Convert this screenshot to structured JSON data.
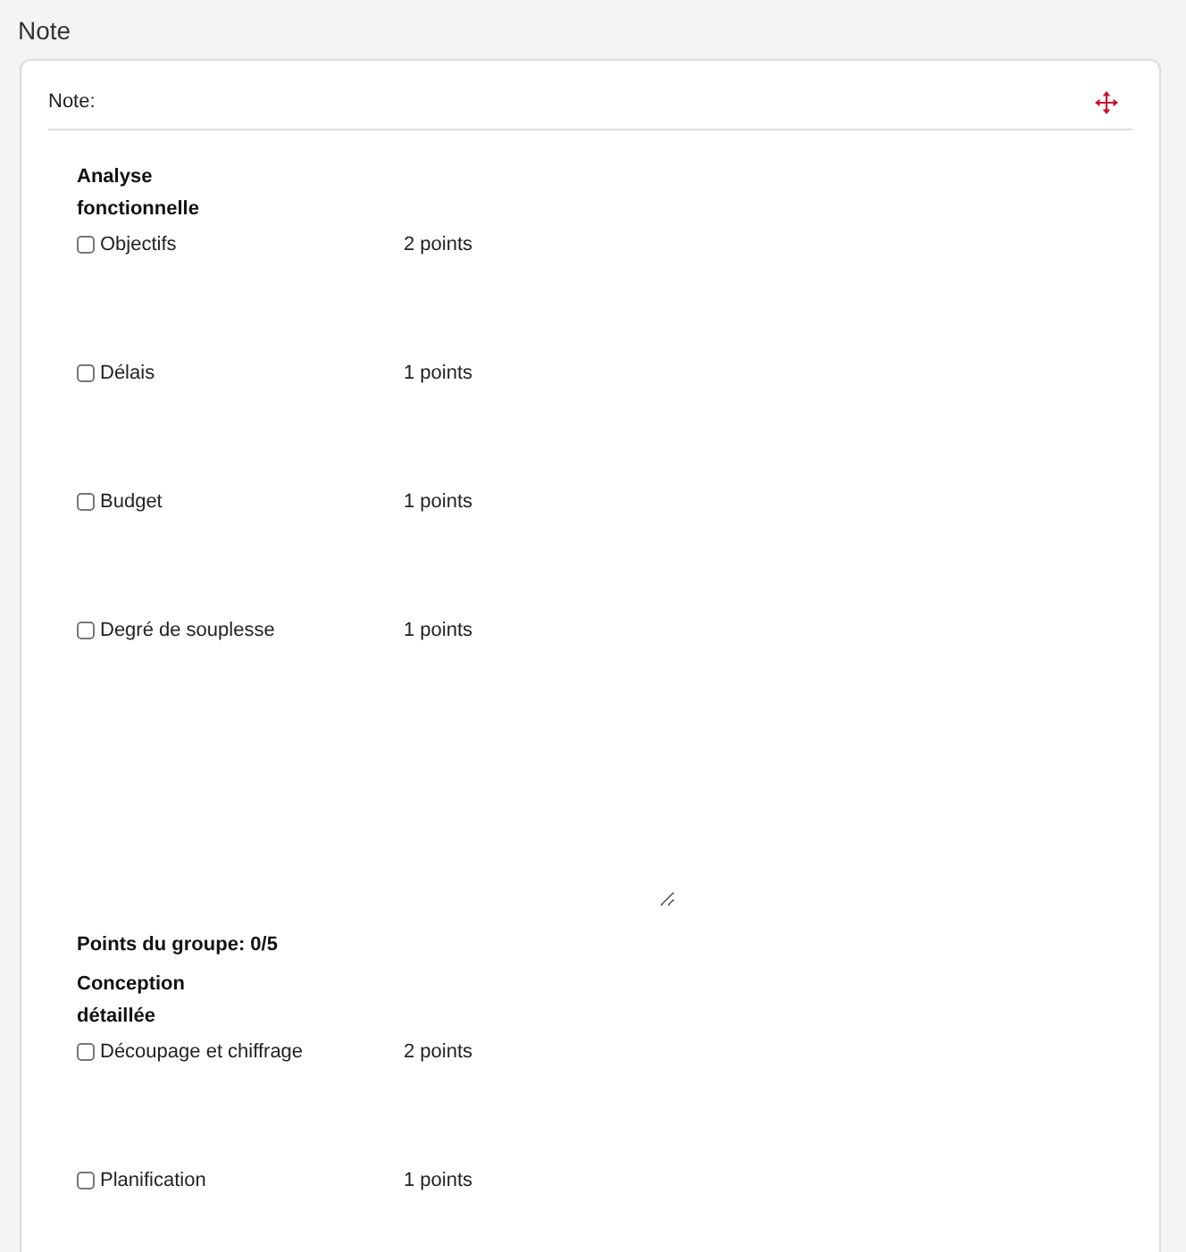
{
  "page_title": "Note",
  "card": {
    "header": "Note:",
    "groups": [
      {
        "title": "Analyse fonctionnelle",
        "items": [
          {
            "label": "Objectifs",
            "points": "2 points",
            "checked": false
          },
          {
            "label": "Délais",
            "points": "1 points",
            "checked": false
          },
          {
            "label": "Budget",
            "points": "1 points",
            "checked": false
          },
          {
            "label": "Degré de souplesse",
            "points": "1 points",
            "checked": false
          }
        ],
        "comment": {
          "kind": "textarea"
        },
        "total": "Points du groupe: 0/5"
      },
      {
        "title": "Conception détaillée",
        "items": [
          {
            "label": "Découpage et chiffrage",
            "points": "2 points",
            "checked": false
          },
          {
            "label": "Planification",
            "points": "1 points",
            "checked": false
          }
        ]
      }
    ]
  }
}
